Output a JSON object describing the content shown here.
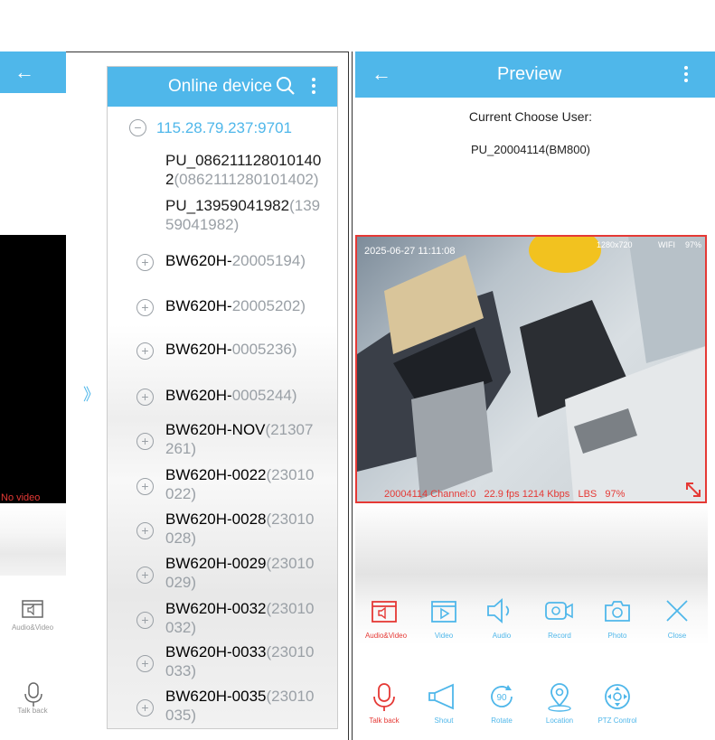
{
  "left_panel": {
    "no_video": "No video",
    "btn_audio_video": "Audio&Video",
    "btn_talk_back": "Talk back"
  },
  "middle_panel": {
    "title": "Online device",
    "server": "115.28.79.237:9701",
    "devices": [
      {
        "line1": "PU_086211128010140",
        "line2_name": "2",
        "line2_id": "(0862111280101402)"
      },
      {
        "line1": "PU_13959041982",
        "line1_id": "(139",
        "line2_id": "59041982)"
      },
      {
        "name": "BW620H-",
        "id": "20005194)"
      },
      {
        "name": "BW620H-",
        "id": "20005202)"
      },
      {
        "name": "BW620H-",
        "id": "0005236)"
      },
      {
        "name": "BW620H-",
        "id": "0005244)"
      },
      {
        "name": "BW620H-NOV",
        "id1": "(21307",
        "id2": "261)"
      },
      {
        "name": "BW620H-0022",
        "id1": "(23010",
        "id2": "022)"
      },
      {
        "name": "BW620H-0028",
        "id1": "(23010",
        "id2": "028)"
      },
      {
        "name": "BW620H-0029",
        "id1": "(23010",
        "id2": "029)"
      },
      {
        "name": "BW620H-0032",
        "id1": "(23010",
        "id2": "032)"
      },
      {
        "name": "BW620H-0033",
        "id1": "(23010",
        "id2": "033)"
      },
      {
        "name": "BW620H-0035",
        "id1": "(23010",
        "id2": "035)"
      }
    ],
    "arrow": "》"
  },
  "right_panel": {
    "title": "Preview",
    "current_user_label": "Current Choose User:",
    "current_user": "PU_20004114(BM800)",
    "video": {
      "timestamp": "2025-06-27 11:11:08",
      "resolution": "1280x720",
      "wifi": "WIFI",
      "battery": "97%",
      "status_line": "20004114 Channel:0   22.9 fps 1214 Kbps   LBS   97%"
    },
    "row1": [
      "Audio&Video",
      "Video",
      "Audio",
      "Record",
      "Photo",
      "Close"
    ],
    "row2": [
      "Talk back",
      "Shout",
      "Rotate",
      "Location",
      "PTZ Control"
    ],
    "rotate_value": "90"
  },
  "colors": {
    "accent": "#4fb7ea",
    "red": "#e53935"
  }
}
